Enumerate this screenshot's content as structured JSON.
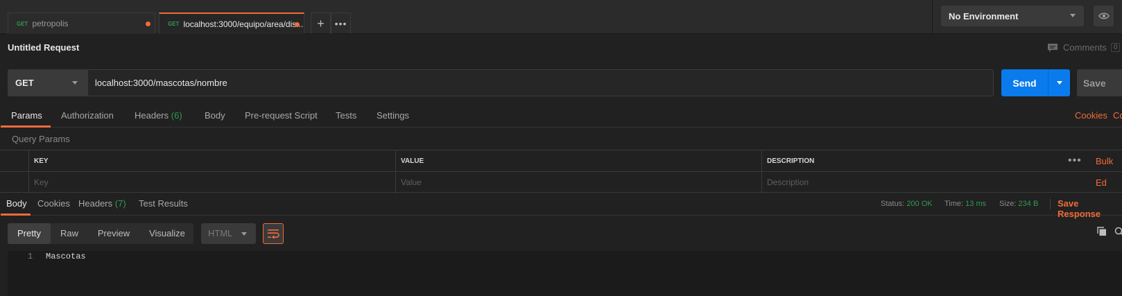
{
  "tabs": [
    {
      "method": "GET",
      "name": "petropolis",
      "unsaved": true,
      "active": false
    },
    {
      "method": "GET",
      "name": "localhost:3000/equipo/area/dis...",
      "unsaved": true,
      "active": true
    }
  ],
  "environment": {
    "selected": "No Environment"
  },
  "request": {
    "title": "Untitled Request",
    "comments_label": "Comments",
    "comments_count": "0",
    "method": "GET",
    "url": "localhost:3000/mascotas/nombre",
    "send_label": "Send",
    "save_label": "Save"
  },
  "request_tabs": {
    "params": "Params",
    "authorization": "Authorization",
    "headers": "Headers",
    "headers_count": "(6)",
    "body": "Body",
    "prerequest": "Pre-request Script",
    "tests": "Tests",
    "settings": "Settings",
    "cookies": "Cookies",
    "code": "Co"
  },
  "query_params": {
    "label": "Query Params",
    "columns": {
      "key": "KEY",
      "value": "VALUE",
      "description": "DESCRIPTION"
    },
    "placeholders": {
      "key": "Key",
      "value": "Value",
      "description": "Description"
    },
    "bulk_edit": "Bulk Ed"
  },
  "response": {
    "tabs": {
      "body": "Body",
      "cookies": "Cookies",
      "headers": "Headers",
      "headers_count": "(7)",
      "test_results": "Test Results"
    },
    "status_label": "Status:",
    "status_value": "200 OK",
    "time_label": "Time:",
    "time_value": "13 ms",
    "size_label": "Size:",
    "size_value": "234 B",
    "save_response": "Save Response",
    "views": {
      "pretty": "Pretty",
      "raw": "Raw",
      "preview": "Preview",
      "visualize": "Visualize"
    },
    "language": "HTML",
    "lines": [
      {
        "number": "1",
        "text": "Mascotas"
      }
    ]
  },
  "colors": {
    "accent": "#f26b3a",
    "send": "#097bed",
    "success": "#2f9a52"
  }
}
